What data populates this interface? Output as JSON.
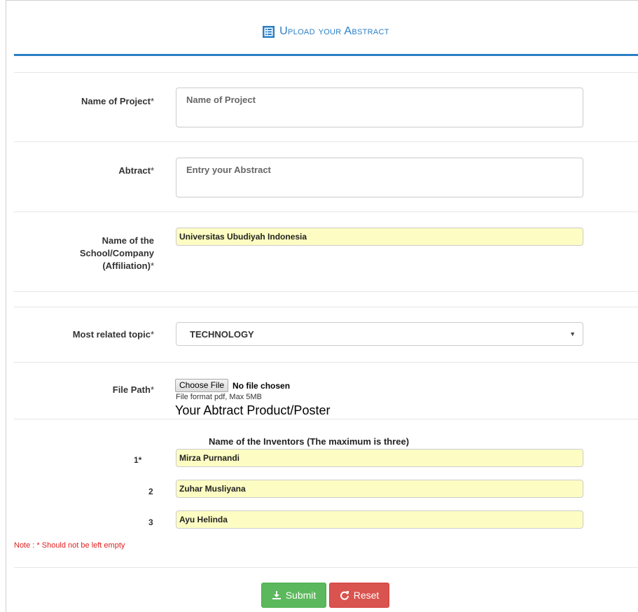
{
  "header": {
    "title": "Upload your Abstract",
    "icon": "list-icon"
  },
  "form": {
    "project": {
      "label": "Name of Project",
      "required": "*",
      "placeholder": "Name of Project",
      "value": ""
    },
    "abstract": {
      "label": "Abtract",
      "required": "*",
      "placeholder": "Entry your Abstract",
      "value": ""
    },
    "affiliation": {
      "label_line1": "Name of the",
      "label_line2": "School/Company",
      "label_line3": "(Affiliation)",
      "required": "*",
      "value": "Universitas Ubudiyah Indonesia"
    },
    "topic": {
      "label": "Most related topic",
      "required": "*",
      "selected": "TECHNOLOGY"
    },
    "file": {
      "label": "File Path",
      "required": "*",
      "button": "Choose File",
      "status": "No file chosen",
      "hint": "File format pdf, Max 5MB",
      "description": "Your Abtract Product/Poster"
    },
    "inventors": {
      "heading": "Name of the Inventors (The maximum is three)",
      "items": [
        {
          "num": "1*",
          "value": "Mirza Purnandi"
        },
        {
          "num": "2",
          "value": "Zuhar Musliyana"
        },
        {
          "num": "3",
          "value": "Ayu Helinda"
        }
      ]
    },
    "note": "Note : * Should not be left empty",
    "submit_label": "Submit",
    "reset_label": "Reset"
  },
  "colors": {
    "accent": "#2a7fc4",
    "submit": "#5cb85c",
    "reset": "#d9534f",
    "highlight": "#fdfdc3",
    "note": "#e02020"
  }
}
